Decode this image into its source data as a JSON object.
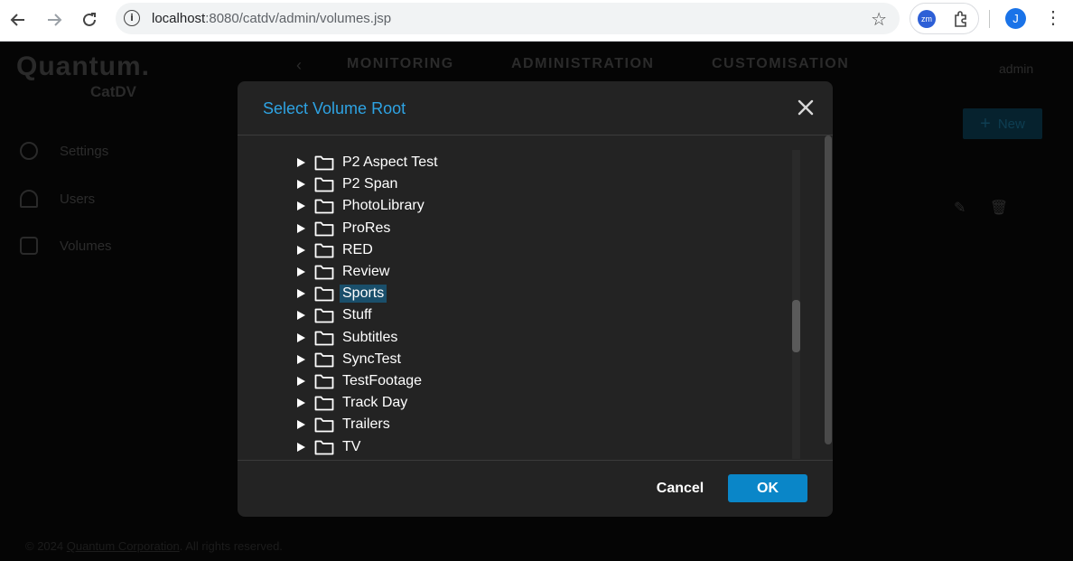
{
  "browser": {
    "url_host": "localhost",
    "url_path": ":8080/catdv/admin/volumes.jsp",
    "ext_zm": "zm",
    "profile_initial": "J"
  },
  "app": {
    "logo_main": "Quantum.",
    "logo_sub": "CatDV",
    "nav": {
      "monitoring": "MONITORING",
      "administration": "ADMINISTRATION",
      "customisation": "CUSTOMISATION"
    },
    "user": "admin",
    "new_label": "New",
    "sidebar": [
      {
        "label": "Settings",
        "icon": "gear-icon"
      },
      {
        "label": "Users",
        "icon": "user-icon"
      },
      {
        "label": "Volumes",
        "icon": "volumes-icon"
      }
    ],
    "footer_prefix": "© 2024 ",
    "footer_link": "Quantum Corporation",
    "footer_suffix": ". All rights reserved."
  },
  "dialog": {
    "title": "Select Volume Root",
    "selected": "Sports",
    "folders": [
      "P2 Aspect Test",
      "P2 Span",
      "PhotoLibrary",
      "ProRes",
      "RED",
      "Review",
      "Sports",
      "Stuff",
      "Subtitles",
      "SyncTest",
      "TestFootage",
      "Track Day",
      "Trailers",
      "TV"
    ],
    "cancel_label": "Cancel",
    "ok_label": "OK"
  },
  "colors": {
    "accent": "#2ea3e3",
    "ok_button": "#0a86c8",
    "selection": "#1a4f6b",
    "dialog_bg": "#232323"
  }
}
